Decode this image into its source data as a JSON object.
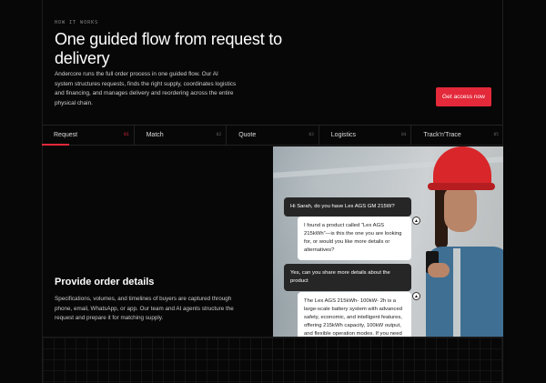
{
  "eyebrow": "HOW IT WORKS",
  "headline": "One guided flow from request to delivery",
  "intro": "Andercore runs the full order process in one guided flow. Our AI system structures requests, finds the right supply, coordinates logistics and financing, and manages delivery and reordering across the entire physical chain.",
  "cta_label": "Get access now",
  "tabs": [
    {
      "label": "Request",
      "num": "01"
    },
    {
      "label": "Match",
      "num": "02"
    },
    {
      "label": "Quote",
      "num": "03"
    },
    {
      "label": "Logistics",
      "num": "04"
    },
    {
      "label": "Track'n'Trace",
      "num": "05"
    }
  ],
  "section": {
    "title": "Provide order details",
    "description": "Specifications, volumes, and timelines of buyers are captured through phone, email, WhatsApp, or app. Our team and AI agents structure the request and prepare it for matching supply."
  },
  "chat": [
    {
      "text": "Hi Sarah, do you have Lex AGS GM 215W?"
    },
    {
      "text": "I found a product called “Lex AGS 215kWh”—is this the one you are looking for, or would you like more details or alternatives?"
    },
    {
      "text": "Yes, can you share more details about the product"
    },
    {
      "text": "The Lex AGS 215kWh- 100kW- 2h is a large-scale battery system with advanced safety, economic, and intelligent features, offering 215kWh capacity, 100kW output, and flexible operation modes. If you need"
    }
  ],
  "colors": {
    "accent": "#e3293a",
    "background": "#070707"
  },
  "icons": {
    "bot": "triangle-logo-icon"
  }
}
